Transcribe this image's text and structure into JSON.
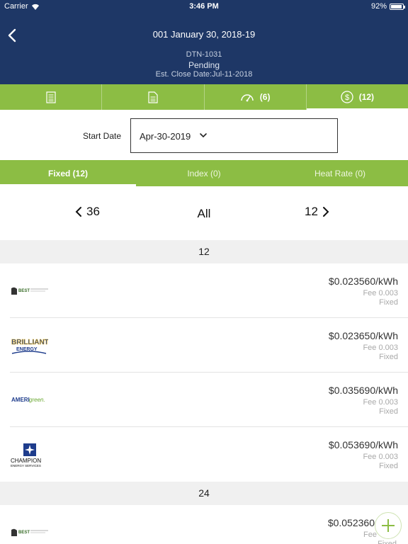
{
  "status_bar": {
    "carrier": "Carrier",
    "time": "3:46 PM",
    "battery": "92%",
    "battery_level": 0.92
  },
  "header": {
    "title": "001 January 30, 2018-19",
    "deal_id": "DTN-1031",
    "status": "Pending",
    "est_close": "Est. Close Date:Jul-11-2018"
  },
  "icon_tabs": [
    {
      "icon": "list-icon",
      "count": ""
    },
    {
      "icon": "document-icon",
      "count": ""
    },
    {
      "icon": "gauge-icon",
      "count": "(6)"
    },
    {
      "icon": "dollar-icon",
      "count": "(12)",
      "active": true
    }
  ],
  "start_date": {
    "label": "Start Date",
    "value": "Apr-30-2019"
  },
  "rate_tabs": [
    {
      "label": "Fixed (12)",
      "active": true
    },
    {
      "label": "Index (0)"
    },
    {
      "label": "Heat Rate (0)"
    }
  ],
  "term_nav": {
    "prev": "36",
    "current": "All",
    "next": "12"
  },
  "sections": [
    {
      "term": "12",
      "offers": [
        {
          "supplier_logo": "best-energy-logo",
          "price": "$0.023560/kWh",
          "fee": "Fee 0.003",
          "type": "Fixed"
        },
        {
          "supplier_logo": "brilliant-energy-logo",
          "price": "$0.023650/kWh",
          "fee": "Fee 0.003",
          "type": "Fixed"
        },
        {
          "supplier_logo": "amerigreen-logo",
          "price": "$0.035690/kWh",
          "fee": "Fee 0.003",
          "type": "Fixed"
        },
        {
          "supplier_logo": "champion-energy-logo",
          "price": "$0.053690/kWh",
          "fee": "Fee 0.003",
          "type": "Fixed"
        }
      ]
    },
    {
      "term": "24",
      "offers": [
        {
          "supplier_logo": "best-energy-logo",
          "price": "$0.052360",
          "fee": "Fee",
          "type": "Fixed"
        }
      ]
    }
  ],
  "logo_text": {
    "brilliant_1": "BRILLIANT",
    "brilliant_2": "ENERGY",
    "ameri": "AMERI",
    "green": "green.",
    "champion_1": "CHAMPION",
    "champion_2": "ENERGY SERVICES",
    "best": "BEST"
  },
  "colors": {
    "header": "#1e3766",
    "accent_green": "#8cbd44",
    "section_bg": "#f0f0f0"
  }
}
